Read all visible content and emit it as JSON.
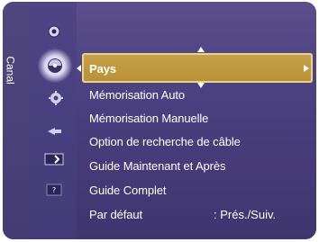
{
  "category": "Canal",
  "icons": [
    {
      "name": "antenna-icon"
    },
    {
      "name": "channel-dish-icon"
    },
    {
      "name": "settings-icon"
    },
    {
      "name": "input-icon"
    },
    {
      "name": "application-icon"
    },
    {
      "name": "support-icon"
    }
  ],
  "menu": {
    "selected": "Pays",
    "items": [
      "Mémorisation Auto",
      "Mémorisation Manuelle",
      "Option de recherche de câble",
      "Guide Maintenant et Après",
      "Guide Complet",
      "Par défaut"
    ],
    "default_value": ": Prés./Suiv."
  },
  "colors": {
    "panel": "#4b4080",
    "highlight": "#c7a24a",
    "text": "#ffffff"
  }
}
